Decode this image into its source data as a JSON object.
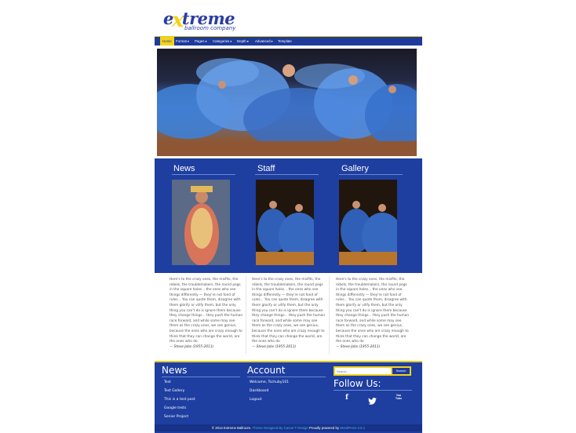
{
  "logo": {
    "pre": "e",
    "x": "x",
    "post": "treme",
    "sub": "ballroom company"
  },
  "nav": {
    "items": [
      {
        "label": "Home",
        "caret": ""
      },
      {
        "label": "Format",
        "caret": "▾"
      },
      {
        "label": "Pages",
        "caret": "▾"
      },
      {
        "label": "Categories",
        "caret": "▾"
      },
      {
        "label": "Depth",
        "caret": "▾"
      },
      {
        "label": "Advanced",
        "caret": "▾"
      },
      {
        "label": "Template",
        "caret": ""
      }
    ]
  },
  "columns": [
    {
      "title": "News"
    },
    {
      "title": "Staff"
    },
    {
      "title": "Gallery"
    }
  ],
  "quote": {
    "text": "Here's to the crazy ones, the misfits, the rebels, the troublemakers, the round pegs in the square holes... the ones who see things differently — they're not fond of rules... You can quote them, disagree with them glorify or vilify them, but the only thing you can't do is ignore them because they change things... they push the human race forward, and while some may see them as the crazy ones, we see genius, because the ones who are crazy enough to think that they can change the world, are the ones who do",
    "signature": "— Steve Jobs (1955-2011)"
  },
  "footer": {
    "news_heading": "News",
    "news_links": [
      "Test",
      "Test Gallery",
      "This is a test post",
      "Google tests",
      "Senior Project"
    ],
    "account_heading": "Account",
    "account_links": [
      "Welcome, Tschuby101",
      "Dashboard",
      "Logout"
    ],
    "search_placeholder": "Search ...",
    "search_button": "Search",
    "follow_heading": "Follow Us:",
    "social": [
      "f",
      "twitter-bird",
      "You Tube"
    ],
    "copyright": "© 2014 Extreme Ballroom.",
    "theme_link": "Theme Designed By Canon-T Design",
    "powered": "Proudly powered by",
    "wp_link": "WordPress 3.8.1"
  },
  "colors": {
    "brand_blue": "#1e3ea0",
    "accent_yellow": "#f2d21b",
    "link_blue": "#3db4f0"
  }
}
